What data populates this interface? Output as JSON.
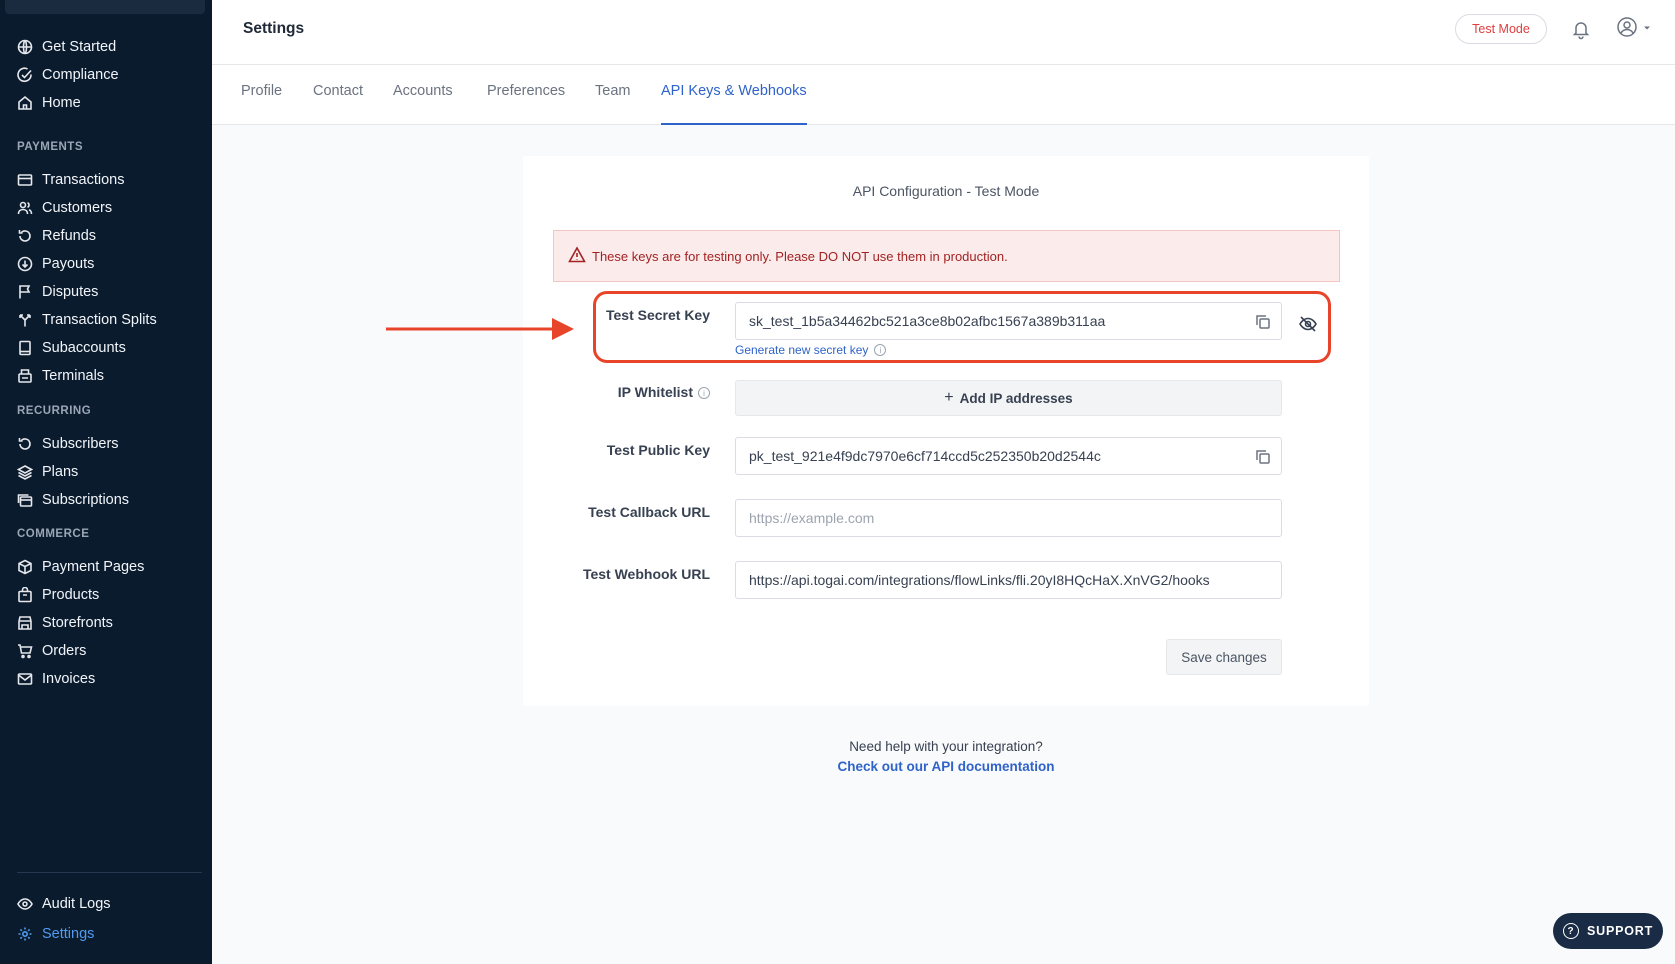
{
  "sidebar": {
    "top_items": [
      {
        "label": "Get Started",
        "icon": "globe-icon"
      },
      {
        "label": "Compliance",
        "icon": "check-circle-icon"
      },
      {
        "label": "Home",
        "icon": "home-icon"
      }
    ],
    "sections": [
      {
        "title": "PAYMENTS",
        "items": [
          {
            "label": "Transactions",
            "icon": "card-icon"
          },
          {
            "label": "Customers",
            "icon": "users-icon"
          },
          {
            "label": "Refunds",
            "icon": "refund-icon"
          },
          {
            "label": "Payouts",
            "icon": "payout-icon"
          },
          {
            "label": "Disputes",
            "icon": "flag-icon"
          },
          {
            "label": "Transaction Splits",
            "icon": "split-icon"
          },
          {
            "label": "Subaccounts",
            "icon": "subaccount-icon"
          },
          {
            "label": "Terminals",
            "icon": "terminal-icon"
          }
        ]
      },
      {
        "title": "RECURRING",
        "items": [
          {
            "label": "Subscribers",
            "icon": "refresh-icon"
          },
          {
            "label": "Plans",
            "icon": "layers-icon"
          },
          {
            "label": "Subscriptions",
            "icon": "subscriptions-icon"
          }
        ]
      },
      {
        "title": "COMMERCE",
        "items": [
          {
            "label": "Payment Pages",
            "icon": "box-icon"
          },
          {
            "label": "Products",
            "icon": "package-icon"
          },
          {
            "label": "Storefronts",
            "icon": "storefront-icon"
          },
          {
            "label": "Orders",
            "icon": "cart-icon"
          },
          {
            "label": "Invoices",
            "icon": "mail-icon"
          }
        ]
      }
    ],
    "bottom_items": [
      {
        "label": "Audit Logs",
        "icon": "eye-icon"
      },
      {
        "label": "Settings",
        "icon": "gear-icon",
        "active": true
      }
    ]
  },
  "header": {
    "title": "Settings",
    "test_mode_label": "Test Mode"
  },
  "tabs": [
    {
      "label": "Profile"
    },
    {
      "label": "Contact"
    },
    {
      "label": "Accounts"
    },
    {
      "label": "Preferences"
    },
    {
      "label": "Team"
    },
    {
      "label": "API Keys & Webhooks",
      "active": true
    }
  ],
  "card": {
    "title": "API Configuration - Test Mode",
    "warning": "These keys are for testing only. Please DO NOT use them in production.",
    "secret_key": {
      "label": "Test Secret Key",
      "value": "sk_test_1b5a34462bc521a3ce8b02afbc1567a389b311aa",
      "generate_link": "Generate new secret key"
    },
    "ip_whitelist": {
      "label": "IP Whitelist",
      "button": "Add IP addresses"
    },
    "public_key": {
      "label": "Test Public Key",
      "value": "pk_test_921e4f9dc7970e6cf714ccd5c252350b20d2544c"
    },
    "callback_url": {
      "label": "Test Callback URL",
      "value": "",
      "placeholder": "https://example.com"
    },
    "webhook_url": {
      "label": "Test Webhook URL",
      "value": "https://api.togai.com/integrations/flowLinks/fli.20yI8HQcHaX.XnVG2/hooks"
    },
    "save_label": "Save changes"
  },
  "help": {
    "text": "Need help with your integration?",
    "link": "Check out our API documentation"
  },
  "support_label": "SUPPORT",
  "colors": {
    "sidebar_bg": "#0b1b2e",
    "accent": "#2f63c9",
    "highlight": "#e8442a",
    "warning_bg": "#fcebeb"
  }
}
